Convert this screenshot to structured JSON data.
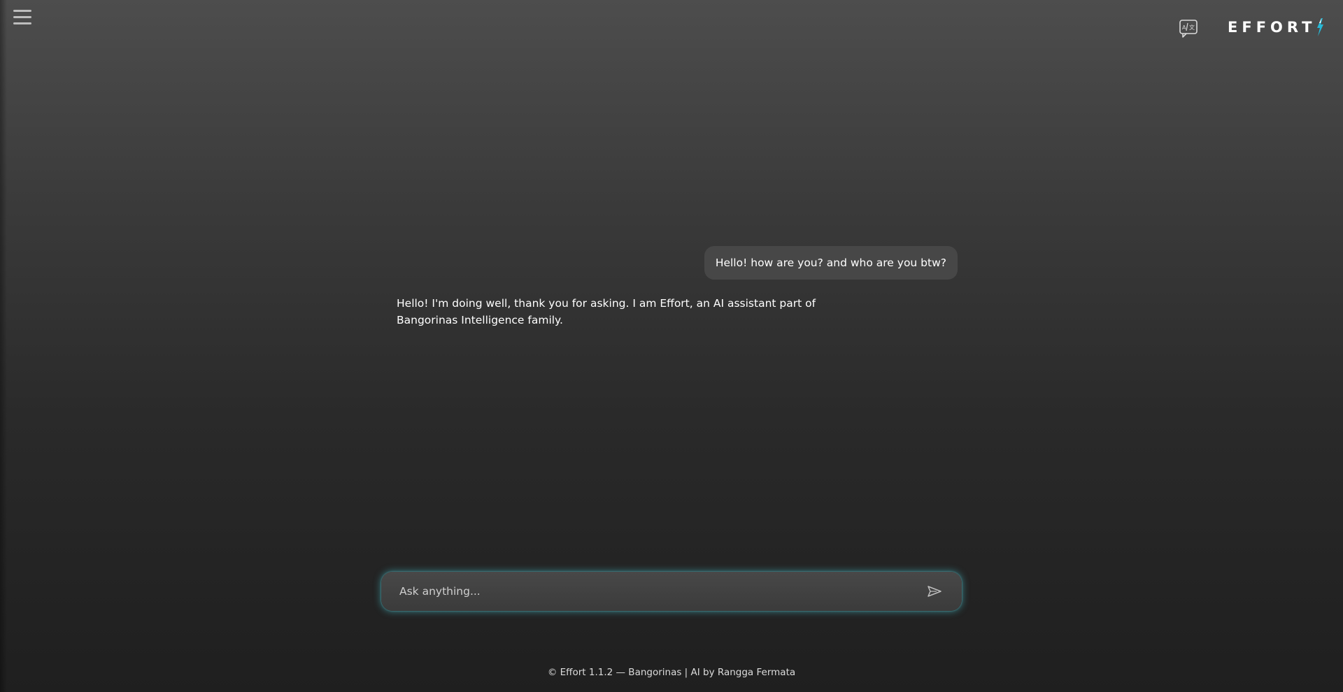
{
  "header": {
    "menu_icon": "hamburger-menu-icon",
    "translate_icon": "translate-icon",
    "logo_text": "EFFORT",
    "brand_accent": "#27b8d6"
  },
  "conversation": {
    "messages": [
      {
        "role": "user",
        "text": "Hello! how are you? and who are you btw?"
      },
      {
        "role": "assistant",
        "text": "Hello! I'm doing well, thank you for asking. I am Effort, an AI assistant part of Bangorinas Intelligence family."
      }
    ]
  },
  "composer": {
    "placeholder": "Ask anything...",
    "value": "",
    "send_icon": "send-icon",
    "glow_color": "#46bec8"
  },
  "footer": {
    "text": "© Effort 1.1.2 — Bangorinas | AI by Rangga Fermata"
  }
}
